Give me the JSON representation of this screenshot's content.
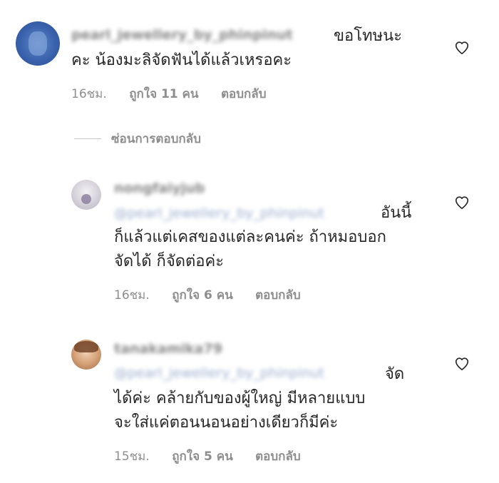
{
  "comments": [
    {
      "username": "pearl_jewellery_by_phinpinut",
      "text_lines": [
        "ขอโทษนะ",
        "คะ น้องมะลิจัดฟันได้แล้วเหรอคะ"
      ],
      "time": "16ชม.",
      "likes": "ถูกใจ 11 คน",
      "reply_label": "ตอบกลับ"
    }
  ],
  "hide_replies_label": "ซ่อนการตอบกลับ",
  "replies": [
    {
      "username": "nongfaiyjub",
      "mention": "@pearl_jewellery_by_phinpinut",
      "text_lines": [
        "อันนี้",
        "ก็แล้วแต่เคสของแต่ละคนค่ะ ถ้าหมอบอก",
        "จัดได้ ก็จัดต่อค่ะ"
      ],
      "time": "16ชม.",
      "likes": "ถูกใจ 6 คน",
      "reply_label": "ตอบกลับ"
    },
    {
      "username": "tanakamika79",
      "mention": "@pearl_jewellery_by_phinpinut",
      "text_lines": [
        "จัด",
        "ได้ค่ะ คล้ายกับของผู้ใหญ่ มีหลายแบบ",
        "จะใส่แค่ตอนนอนอย่างเดียวก็มีค่ะ"
      ],
      "time": "15ชม.",
      "likes": "ถูกใจ 5 คน",
      "reply_label": "ตอบกลับ"
    }
  ],
  "icons": {
    "like": "heart-outline-icon"
  },
  "colors": {
    "text": "#262626",
    "meta": "#8e8e8e",
    "mention": "#4a6da7",
    "divider": "#c7c7c7"
  }
}
